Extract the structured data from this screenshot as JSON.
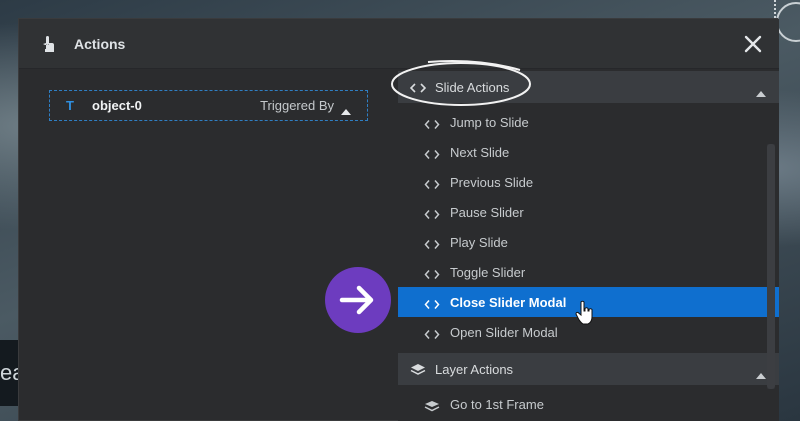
{
  "dialog": {
    "title": "Actions",
    "title_icon": "touch-hand-icon",
    "close_icon": "close-icon"
  },
  "trigger": {
    "type_glyph": "T",
    "object_name": "object-0",
    "mode_label": "Triggered By",
    "caret_icon": "caret-up-icon"
  },
  "categories": {
    "slide": {
      "label": "Slide Actions",
      "icon": "code-brackets-icon",
      "items": [
        {
          "label": "Jump to Slide"
        },
        {
          "label": "Next Slide"
        },
        {
          "label": "Previous Slide"
        },
        {
          "label": "Pause Slider"
        },
        {
          "label": "Play Slide"
        },
        {
          "label": "Toggle Slider"
        },
        {
          "label": "Close Slider Modal",
          "active": true
        },
        {
          "label": "Open Slider Modal"
        }
      ]
    },
    "layer": {
      "label": "Layer Actions",
      "icon": "layers-icon",
      "items": [
        {
          "label": "Go to 1st Frame"
        }
      ]
    }
  },
  "background": {
    "partial_text": "ea"
  },
  "colors": {
    "accent_blue": "#0f6fcf",
    "marker_purple": "#6d3cbf",
    "dialog_bg": "#2b2c2e"
  }
}
